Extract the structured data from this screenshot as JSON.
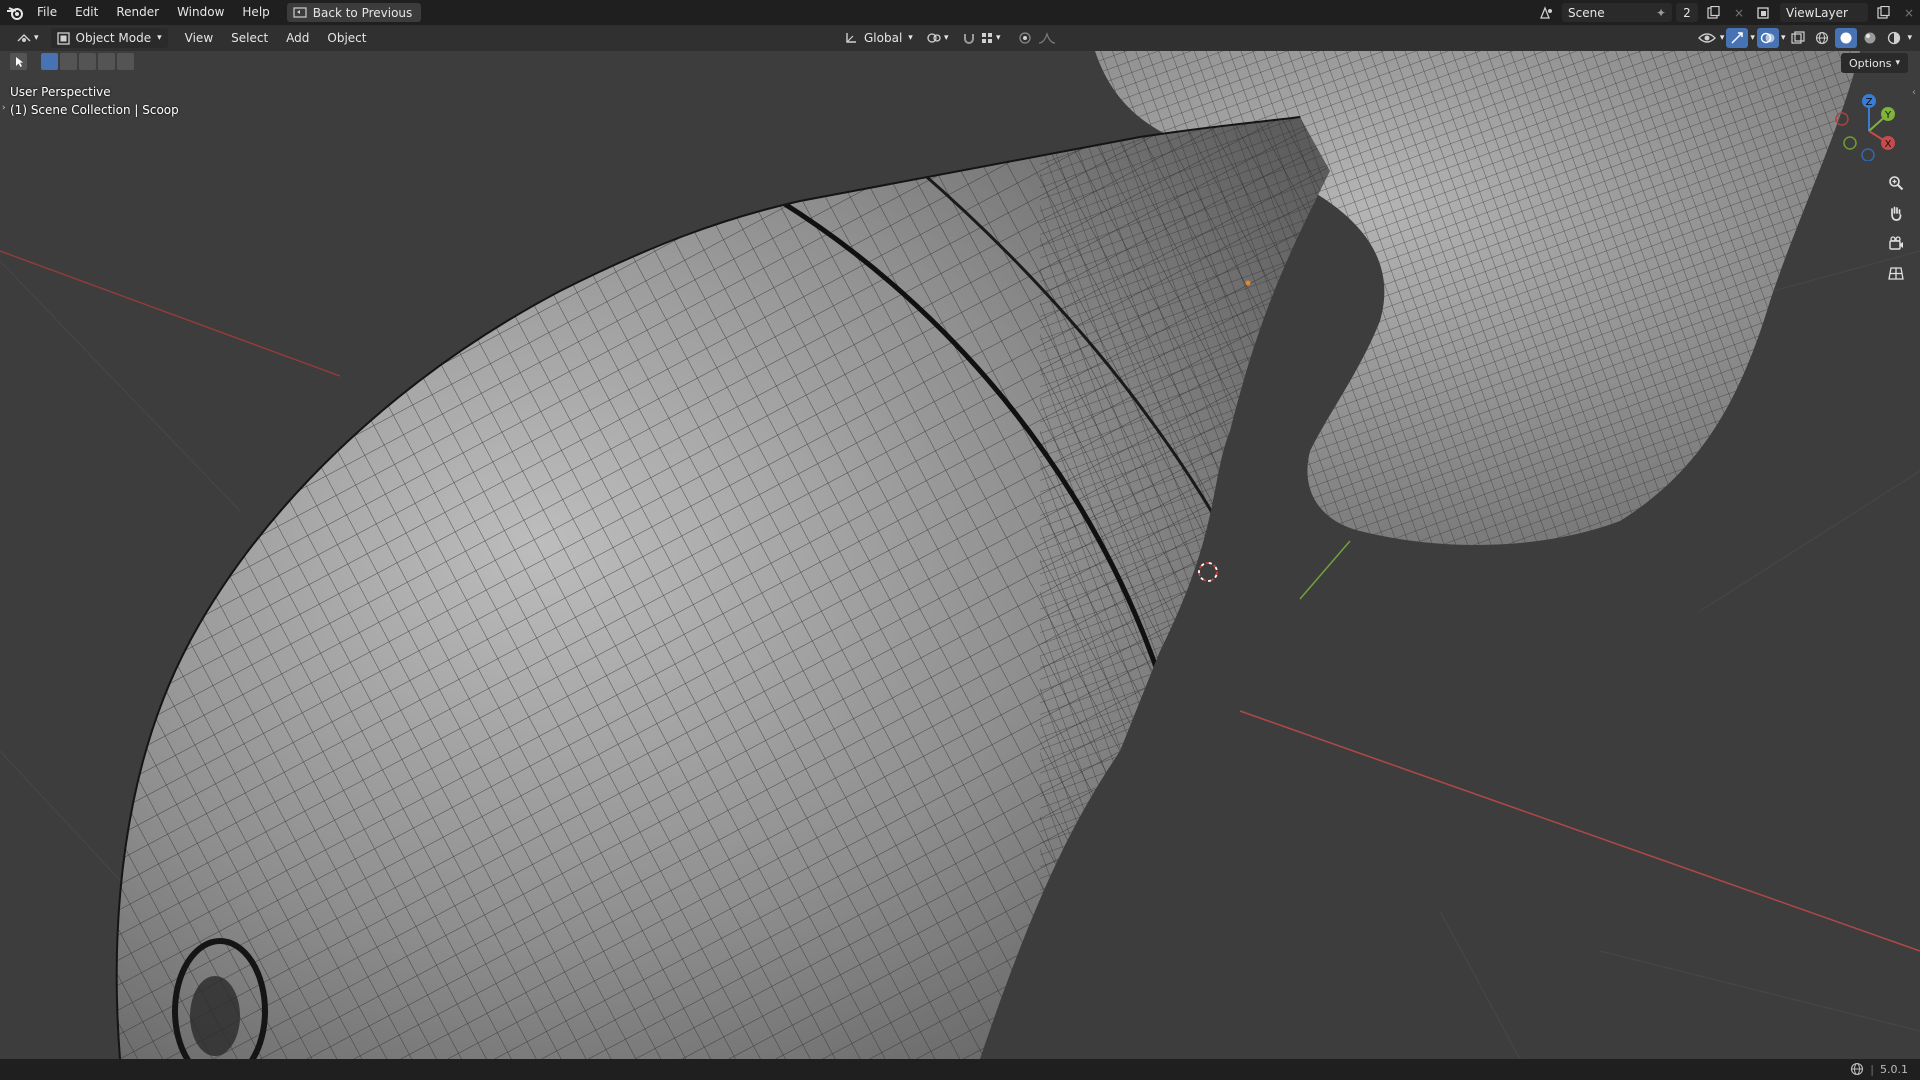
{
  "app": {
    "logo_icon": "blender-logo-icon"
  },
  "menu": {
    "items": [
      "File",
      "Edit",
      "Render",
      "Window",
      "Help"
    ],
    "back_button": "Back to Previous"
  },
  "topright": {
    "scene_label": "Scene",
    "scene_users": "2",
    "viewlayer_label": "ViewLayer"
  },
  "header": {
    "mode": "Object Mode",
    "menus": [
      "View",
      "Select",
      "Add",
      "Object"
    ],
    "transform_orientation": "Global"
  },
  "viewport": {
    "perspective_label": "User Perspective",
    "collection_label": "(1) Scene Collection | Scoop",
    "options_label": "Options",
    "gizmo_axes": [
      "Z",
      "Y",
      "X"
    ]
  },
  "status": {
    "version": "5.0.1"
  },
  "colors": {
    "accent": "#4772b3",
    "x_axis": "#c84b4b",
    "y_axis": "#7fb33a",
    "z_axis": "#3a7bd5"
  }
}
